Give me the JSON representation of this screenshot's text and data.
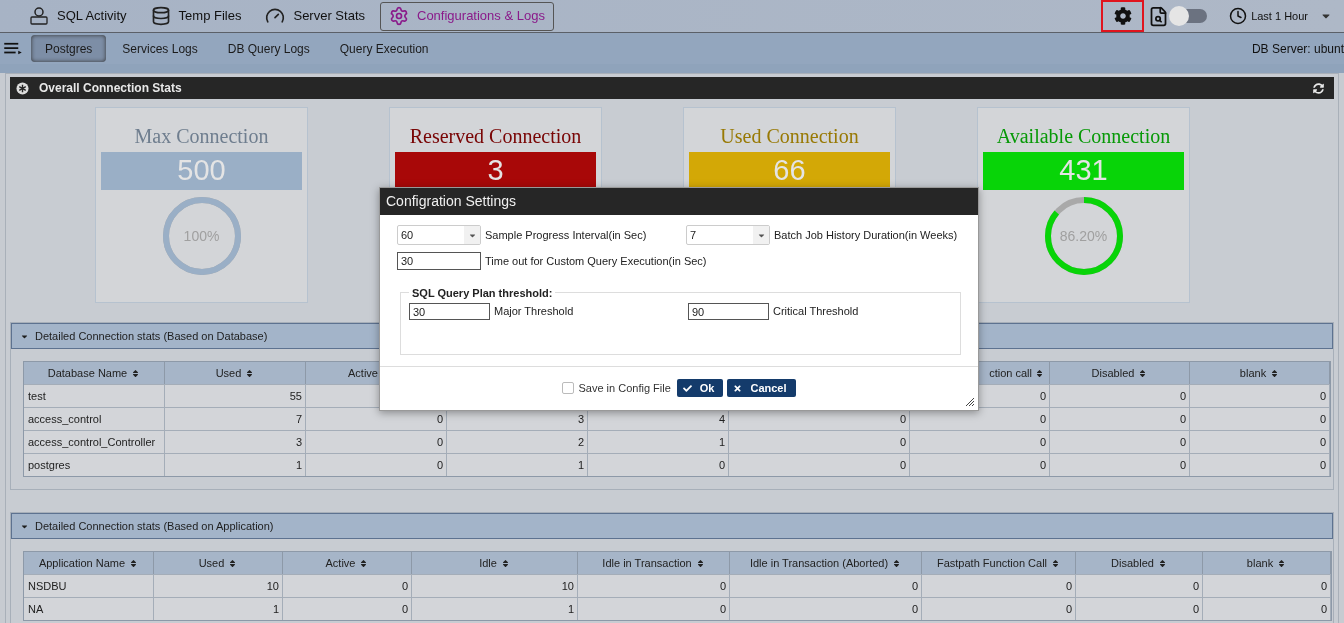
{
  "top_tabs": [
    {
      "label": "SQL Activity",
      "selected": false
    },
    {
      "label": "Temp Files",
      "selected": false
    },
    {
      "label": "Server Stats",
      "selected": false
    },
    {
      "label": "Configurations & Logs",
      "selected": true
    }
  ],
  "toolbar": {
    "settings_highlighted": true,
    "toggle": {
      "on": false
    },
    "time_range": "Last 1 Hour"
  },
  "sub_tabs": [
    {
      "label": "Postgres",
      "selected": true
    },
    {
      "label": "Services Logs",
      "selected": false
    },
    {
      "label": "DB Query Logs",
      "selected": false
    },
    {
      "label": "Query Execution",
      "selected": false
    }
  ],
  "db_server": "DB Server: ubunt",
  "overall_panel": {
    "title": "Overall Connection Stats",
    "cards": [
      {
        "title": "Max Connection",
        "value": "500",
        "color": "#9aafc6",
        "percent": "100%",
        "level": 1
      },
      {
        "title": "Reserved Connection",
        "value": "3",
        "color": "#a80808"
      },
      {
        "title": "Used Connection",
        "value": "66",
        "color": "#d3a806"
      },
      {
        "title": "Available Connection",
        "value": "431",
        "color": "#08d408",
        "percent": "86.20%",
        "level": 0.862
      }
    ]
  },
  "sections": [
    {
      "title": "Detailed Connection stats (Based on Database)",
      "expanded": true,
      "table": {
        "columns": [
          {
            "label": "Database Name"
          },
          {
            "label": "Used"
          },
          {
            "label": "Active"
          },
          {},
          {},
          {},
          {
            "label": "ction call"
          },
          {
            "label": "Disabled"
          },
          {
            "label": "blank"
          }
        ],
        "rows": [
          [
            "test",
            "55",
            null,
            null,
            null,
            null,
            "0",
            "0",
            "0"
          ],
          [
            "access_control",
            "7",
            "0",
            "3",
            "4",
            "0",
            "0",
            "0",
            "0"
          ],
          [
            "access_control_Controller",
            "3",
            "0",
            "2",
            "1",
            "0",
            "0",
            "0",
            "0"
          ],
          [
            "postgres",
            "1",
            "0",
            "1",
            "0",
            "0",
            "0",
            "0",
            "0"
          ]
        ]
      }
    },
    {
      "title": "Detailed Connection stats (Based on Application)",
      "expanded": true,
      "table": {
        "columns": [
          {
            "label": "Application Name"
          },
          {
            "label": "Used"
          },
          {
            "label": "Active"
          },
          {
            "label": "Idle"
          },
          {
            "label": "Idle in Transaction"
          },
          {
            "label": "Idle in Transaction (Aborted)"
          },
          {
            "label": "Fastpath Function Call"
          },
          {
            "label": "Disabled"
          },
          {
            "label": "blank"
          }
        ],
        "rows": [
          [
            "NSDBU",
            "10",
            "0",
            "10",
            "0",
            "0",
            "0",
            "0",
            "0"
          ],
          [
            "NA",
            "1",
            "0",
            "1",
            "0",
            "0",
            "0",
            "0",
            "0"
          ]
        ]
      }
    }
  ],
  "modal": {
    "title": "Configration Settings",
    "fields": [
      {
        "kind": "select",
        "value": "60",
        "trailing_text": "Sample Progress Interval(in Sec)"
      },
      {
        "kind": "select",
        "value": "7",
        "trailing_text": "Batch Job History Duration(in Weeks)"
      },
      {
        "kind": "input",
        "value": "30",
        "trailing_text": "Time out for Custom Query Execution(in Sec)"
      }
    ],
    "threshold_group": {
      "legend": "SQL Query Plan threshold:",
      "fields": [
        {
          "value": "30",
          "trailing_text": "Major Threshold"
        },
        {
          "value": "90",
          "trailing_text": "Critical Threshold"
        }
      ]
    },
    "save_in_config": {
      "label": "Save in Config File",
      "checked": false
    },
    "buttons": [
      {
        "kind": "ok",
        "label": "Ok"
      },
      {
        "kind": "cancel",
        "label": "Cancel"
      }
    ]
  }
}
